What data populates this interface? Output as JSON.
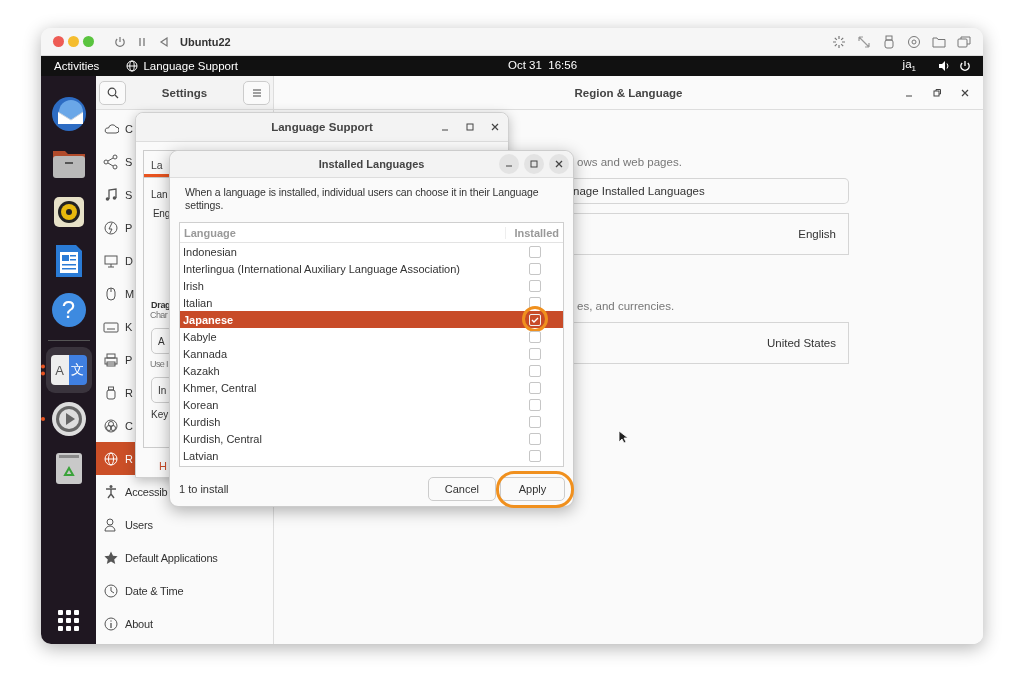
{
  "vm_window": {
    "title": "Ubuntu22"
  },
  "top_bar": {
    "activities": "Activities",
    "app_name": "Language Support",
    "clock": "Oct 31  16:56",
    "input_source": "ja$_{1}$"
  },
  "dock": {
    "items": [
      {
        "kind": "mail",
        "active": false,
        "running": false
      },
      {
        "kind": "files",
        "active": false,
        "running": false
      },
      {
        "kind": "music",
        "active": false,
        "running": false
      },
      {
        "kind": "writer",
        "active": false,
        "running": false
      },
      {
        "kind": "help",
        "glyph": "?",
        "active": false,
        "running": false
      },
      {
        "kind": "language",
        "glyphs": [
          "A",
          "文"
        ],
        "active": true,
        "running": true
      },
      {
        "kind": "settings",
        "active": false,
        "running": true
      },
      {
        "kind": "trash",
        "active": false,
        "running": false
      }
    ]
  },
  "settings": {
    "sidebar_title": "Settings",
    "page_title": "Region & Language",
    "sidebar_items": [
      {
        "kind": "cloud",
        "label": "C",
        "selected": false
      },
      {
        "kind": "share",
        "label": "S",
        "selected": false
      },
      {
        "kind": "music",
        "label": "S",
        "selected": false
      },
      {
        "kind": "power",
        "label": "P",
        "selected": false
      },
      {
        "kind": "display",
        "label": "D",
        "selected": false
      },
      {
        "kind": "mouse",
        "label": "M",
        "selected": false
      },
      {
        "kind": "keyboard",
        "label": "K",
        "selected": false
      },
      {
        "kind": "printer",
        "label": "P",
        "selected": false
      },
      {
        "kind": "usb",
        "label": "R",
        "selected": false
      },
      {
        "kind": "color",
        "label": "C",
        "selected": false
      },
      {
        "kind": "globe",
        "label": "R",
        "selected": true
      },
      {
        "kind": "accessibility",
        "label": "Accessib",
        "selected": false
      },
      {
        "kind": "users",
        "label": "Users",
        "selected": false
      },
      {
        "kind": "star",
        "label": "Default Applications",
        "selected": false
      },
      {
        "kind": "clock",
        "label": "Date & Time",
        "selected": false
      },
      {
        "kind": "info",
        "label": "About",
        "selected": false
      }
    ],
    "sections": [
      {
        "description": "ows and web pages.",
        "button": "nage Installed Languages",
        "value": "English"
      },
      {
        "description": "es, and currencies.",
        "value": "United States"
      }
    ]
  },
  "language_support": {
    "title": "Language Support",
    "tab": "La",
    "help_button": "H",
    "fragments": [
      {
        "kind": "label",
        "text": "Lan"
      },
      {
        "kind": "value",
        "text": "Eng"
      },
      {
        "kind": "heading",
        "text": "Drag"
      },
      {
        "kind": "hint",
        "text": "Char"
      },
      {
        "kind": "button",
        "text": "A"
      },
      {
        "kind": "hint",
        "text": "Use I"
      },
      {
        "kind": "button",
        "text": "In"
      },
      {
        "kind": "label",
        "text": "Key"
      }
    ]
  },
  "installed_languages": {
    "title": "Installed Languages",
    "description": "When a language is installed, individual users can choose it in their Language settings.",
    "columns": [
      "Language",
      "Installed"
    ],
    "rows": [
      {
        "name": "Indonesian",
        "installed": false,
        "selected": false,
        "highlighted": false
      },
      {
        "name": "Interlingua (International Auxiliary Language Association)",
        "installed": false,
        "selected": false,
        "highlighted": false
      },
      {
        "name": "Irish",
        "installed": false,
        "selected": false,
        "highlighted": false
      },
      {
        "name": "Italian",
        "installed": false,
        "selected": false,
        "highlighted": false
      },
      {
        "name": "Japanese",
        "installed": true,
        "selected": true,
        "highlighted": true
      },
      {
        "name": "Kabyle",
        "installed": false,
        "selected": false,
        "highlighted": false
      },
      {
        "name": "Kannada",
        "installed": false,
        "selected": false,
        "highlighted": false
      },
      {
        "name": "Kazakh",
        "installed": false,
        "selected": false,
        "highlighted": false
      },
      {
        "name": "Khmer, Central",
        "installed": false,
        "selected": false,
        "highlighted": false
      },
      {
        "name": "Korean",
        "installed": false,
        "selected": false,
        "highlighted": false
      },
      {
        "name": "Kurdish",
        "installed": false,
        "selected": false,
        "highlighted": false
      },
      {
        "name": "Kurdish, Central",
        "installed": false,
        "selected": false,
        "highlighted": false
      },
      {
        "name": "Latvian",
        "installed": false,
        "selected": false,
        "highlighted": false
      }
    ],
    "status": "1 to install",
    "buttons": [
      {
        "label": "Cancel",
        "highlighted": false
      },
      {
        "label": "Apply",
        "highlighted": true
      }
    ]
  }
}
